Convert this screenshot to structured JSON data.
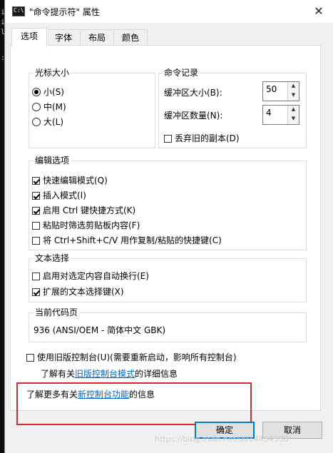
{
  "console_strip": {
    "lines": [
      "i",
      "i",
      "l",
      ":"
    ]
  },
  "window": {
    "title": "\"命令提示符\" 属性",
    "close_glyph": "✕",
    "icon_text": "C:\\"
  },
  "tabs": [
    {
      "label": "选项",
      "active": true
    },
    {
      "label": "字体",
      "active": false
    },
    {
      "label": "布局",
      "active": false
    },
    {
      "label": "颜色",
      "active": false
    }
  ],
  "cursor_size": {
    "title": "光标大小",
    "options": [
      {
        "label": "小(S)",
        "checked": true
      },
      {
        "label": "中(M)",
        "checked": false
      },
      {
        "label": "大(L)",
        "checked": false
      }
    ]
  },
  "command_history": {
    "title": "命令记录",
    "buffer_size_label": "缓冲区大小(B):",
    "buffer_size_value": "50",
    "buffer_count_label": "缓冲区数量(N):",
    "buffer_count_value": "4",
    "discard_old_label": "丢弃旧的副本(D)",
    "discard_old_checked": false
  },
  "edit_options": {
    "title": "编辑选项",
    "items": [
      {
        "label": "快速编辑模式(Q)",
        "checked": true
      },
      {
        "label": "插入模式(I)",
        "checked": true
      },
      {
        "label": "启用 Ctrl 键快捷方式(K)",
        "checked": true
      },
      {
        "label": "粘贴时筛选剪贴板内容(F)",
        "checked": false
      },
      {
        "label": "将 Ctrl+Shift+C/V 用作复制/粘贴的快捷键(C)",
        "checked": false
      }
    ]
  },
  "text_selection": {
    "title": "文本选择",
    "items": [
      {
        "label": "启用对选定内容自动换行(E)",
        "checked": false
      },
      {
        "label": "扩展的文本选择键(X)",
        "checked": true
      }
    ]
  },
  "codepage": {
    "title": "当前代码页",
    "value": "936   (ANSI/OEM - 简体中文 GBK)"
  },
  "legacy": {
    "checkbox_label": "使用旧版控制台(U)(需要重新启动，影响所有控制台)",
    "checked": false,
    "info_prefix": "了解有关",
    "info_link": "旧版控制台模式",
    "info_suffix": "的详细信息"
  },
  "learn_more": {
    "prefix": "了解更多有关",
    "link": "新控制台功能",
    "suffix": "的信息"
  },
  "buttons": {
    "ok": "确定",
    "cancel": "取消"
  },
  "watermark": "https://blog.csdn.net/u014454538",
  "colors": {
    "highlight_box": "#e0262a",
    "link": "#0066cc",
    "default_button_border": "#0078d7"
  }
}
